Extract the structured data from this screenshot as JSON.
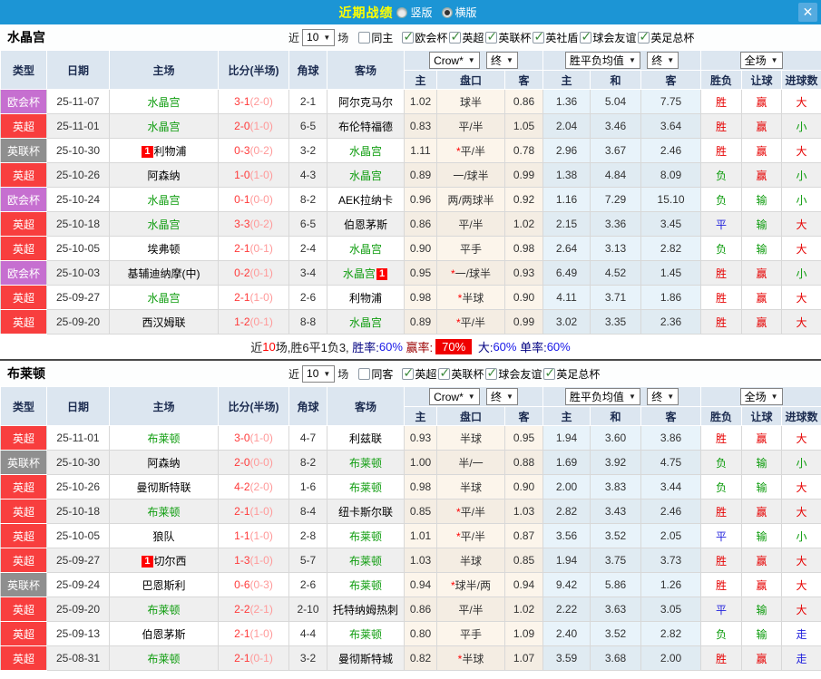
{
  "titlebar": {
    "title": "近期战绩",
    "vertical_label": "竖版",
    "horizontal_label": "横版",
    "selected_mode": "横版",
    "close_label": "✕"
  },
  "columns": {
    "type": "类型",
    "date": "日期",
    "home": "主场",
    "score": "比分(半场)",
    "corner": "角球",
    "away": "客场",
    "select_crow": "Crow*",
    "select_final1": "终",
    "select_avg": "胜平负均值",
    "select_final2": "终",
    "select_full": "全场",
    "sub_headers": [
      "主",
      "盘口",
      "客",
      "主",
      "和",
      "客",
      "胜负",
      "让球",
      "进球数"
    ]
  },
  "type_colors": {
    "欧会杯": "#C66FD0",
    "英超": "#F83E3E",
    "英联杯": "#8F8F8F"
  },
  "result_colors": {
    "胜": "#E60000",
    "赢": "#E60000",
    "大": "#E60000",
    "负": "#0B9B0B",
    "输": "#0B9B0B",
    "小": "#0B9B0B",
    "平": "#2222DD",
    "走": "#2222DD"
  },
  "sections": [
    {
      "team": "水晶宫",
      "near_label": "近",
      "games_value": "10",
      "games_suffix": "场",
      "filters": [
        {
          "label": "同主",
          "checked": false
        },
        {
          "label": "欧会杯",
          "checked": true
        },
        {
          "label": "英超",
          "checked": true
        },
        {
          "label": "英联杯",
          "checked": true
        },
        {
          "label": "英社盾",
          "checked": true
        },
        {
          "label": "球会友谊",
          "checked": true
        },
        {
          "label": "英足总杯",
          "checked": true
        }
      ],
      "rows": [
        {
          "type": "欧会杯",
          "date": "25-11-07",
          "home": "水晶宫",
          "home_green": true,
          "home_badge": null,
          "score": "3-1",
          "half": "(2-0)",
          "corner": "2-1",
          "away": "阿尔克马尔",
          "away_green": false,
          "away_badge": null,
          "odds_h": "1.02",
          "handicap": "球半",
          "star": false,
          "odds_a": "0.86",
          "avg_h": "1.36",
          "avg_d": "5.04",
          "avg_a": "7.75",
          "r_outcome": "胜",
          "r_handicap": "赢",
          "r_goals": "大"
        },
        {
          "type": "英超",
          "date": "25-11-01",
          "home": "水晶宫",
          "home_green": true,
          "home_badge": null,
          "score": "2-0",
          "half": "(1-0)",
          "corner": "6-5",
          "away": "布伦特福德",
          "away_green": false,
          "away_badge": null,
          "odds_h": "0.83",
          "handicap": "平/半",
          "star": false,
          "odds_a": "1.05",
          "avg_h": "2.04",
          "avg_d": "3.46",
          "avg_a": "3.64",
          "r_outcome": "胜",
          "r_handicap": "赢",
          "r_goals": "小"
        },
        {
          "type": "英联杯",
          "date": "25-10-30",
          "home": "利物浦",
          "home_green": false,
          "home_badge": "1",
          "score": "0-3",
          "half": "(0-2)",
          "corner": "3-2",
          "away": "水晶宫",
          "away_green": true,
          "away_badge": null,
          "odds_h": "1.11",
          "handicap": "平/半",
          "star": true,
          "odds_a": "0.78",
          "avg_h": "2.96",
          "avg_d": "3.67",
          "avg_a": "2.46",
          "r_outcome": "胜",
          "r_handicap": "赢",
          "r_goals": "大"
        },
        {
          "type": "英超",
          "date": "25-10-26",
          "home": "阿森纳",
          "home_green": false,
          "home_badge": null,
          "score": "1-0",
          "half": "(1-0)",
          "corner": "4-3",
          "away": "水晶宫",
          "away_green": true,
          "away_badge": null,
          "odds_h": "0.89",
          "handicap": "一/球半",
          "star": false,
          "odds_a": "0.99",
          "avg_h": "1.38",
          "avg_d": "4.84",
          "avg_a": "8.09",
          "r_outcome": "负",
          "r_handicap": "赢",
          "r_goals": "小"
        },
        {
          "type": "欧会杯",
          "date": "25-10-24",
          "home": "水晶宫",
          "home_green": true,
          "home_badge": null,
          "score": "0-1",
          "half": "(0-0)",
          "corner": "8-2",
          "away": "AEK拉纳卡",
          "away_green": false,
          "away_badge": null,
          "odds_h": "0.96",
          "handicap": "两/两球半",
          "star": false,
          "odds_a": "0.92",
          "avg_h": "1.16",
          "avg_d": "7.29",
          "avg_a": "15.10",
          "r_outcome": "负",
          "r_handicap": "输",
          "r_goals": "小"
        },
        {
          "type": "英超",
          "date": "25-10-18",
          "home": "水晶宫",
          "home_green": true,
          "home_badge": null,
          "score": "3-3",
          "half": "(0-2)",
          "corner": "6-5",
          "away": "伯恩茅斯",
          "away_green": false,
          "away_badge": null,
          "odds_h": "0.86",
          "handicap": "平/半",
          "star": false,
          "odds_a": "1.02",
          "avg_h": "2.15",
          "avg_d": "3.36",
          "avg_a": "3.45",
          "r_outcome": "平",
          "r_handicap": "输",
          "r_goals": "大"
        },
        {
          "type": "英超",
          "date": "25-10-05",
          "home": "埃弗顿",
          "home_green": false,
          "home_badge": null,
          "score": "2-1",
          "half": "(0-1)",
          "corner": "2-4",
          "away": "水晶宫",
          "away_green": true,
          "away_badge": null,
          "odds_h": "0.90",
          "handicap": "平手",
          "star": false,
          "odds_a": "0.98",
          "avg_h": "2.64",
          "avg_d": "3.13",
          "avg_a": "2.82",
          "r_outcome": "负",
          "r_handicap": "输",
          "r_goals": "大"
        },
        {
          "type": "欧会杯",
          "date": "25-10-03",
          "home": "基辅迪纳摩(中)",
          "home_green": false,
          "home_badge": null,
          "score": "0-2",
          "half": "(0-1)",
          "corner": "3-4",
          "away": "水晶宫",
          "away_green": true,
          "away_badge": "1",
          "odds_h": "0.95",
          "handicap": "一/球半",
          "star": true,
          "odds_a": "0.93",
          "avg_h": "6.49",
          "avg_d": "4.52",
          "avg_a": "1.45",
          "r_outcome": "胜",
          "r_handicap": "赢",
          "r_goals": "小"
        },
        {
          "type": "英超",
          "date": "25-09-27",
          "home": "水晶宫",
          "home_green": true,
          "home_badge": null,
          "score": "2-1",
          "half": "(1-0)",
          "corner": "2-6",
          "away": "利物浦",
          "away_green": false,
          "away_badge": null,
          "odds_h": "0.98",
          "handicap": "半球",
          "star": true,
          "odds_a": "0.90",
          "avg_h": "4.11",
          "avg_d": "3.71",
          "avg_a": "1.86",
          "r_outcome": "胜",
          "r_handicap": "赢",
          "r_goals": "大"
        },
        {
          "type": "英超",
          "date": "25-09-20",
          "home": "西汉姆联",
          "home_green": false,
          "home_badge": null,
          "score": "1-2",
          "half": "(0-1)",
          "corner": "8-8",
          "away": "水晶宫",
          "away_green": true,
          "away_badge": null,
          "odds_h": "0.89",
          "handicap": "平/半",
          "star": true,
          "odds_a": "0.99",
          "avg_h": "3.02",
          "avg_d": "3.35",
          "avg_a": "2.36",
          "r_outcome": "胜",
          "r_handicap": "赢",
          "r_goals": "大"
        }
      ],
      "summary": {
        "prefix": "近",
        "games": "10",
        "detail": "场,胜6平1负3, ",
        "win_label": "胜率:",
        "win": "60%",
        "profit_label": " 赢率:",
        "profit": "70%",
        "big_label": " 大:",
        "big": "60%",
        "single_label": " 单率:",
        "single": "60%"
      }
    },
    {
      "team": "布莱顿",
      "near_label": "近",
      "games_value": "10",
      "games_suffix": "场",
      "filters": [
        {
          "label": "同客",
          "checked": false
        },
        {
          "label": "英超",
          "checked": true
        },
        {
          "label": "英联杯",
          "checked": true
        },
        {
          "label": "球会友谊",
          "checked": true
        },
        {
          "label": "英足总杯",
          "checked": true
        }
      ],
      "rows": [
        {
          "type": "英超",
          "date": "25-11-01",
          "home": "布莱顿",
          "home_green": true,
          "home_badge": null,
          "score": "3-0",
          "half": "(1-0)",
          "corner": "4-7",
          "away": "利兹联",
          "away_green": false,
          "away_badge": null,
          "odds_h": "0.93",
          "handicap": "半球",
          "star": false,
          "odds_a": "0.95",
          "avg_h": "1.94",
          "avg_d": "3.60",
          "avg_a": "3.86",
          "r_outcome": "胜",
          "r_handicap": "赢",
          "r_goals": "大"
        },
        {
          "type": "英联杯",
          "date": "25-10-30",
          "home": "阿森纳",
          "home_green": false,
          "home_badge": null,
          "score": "2-0",
          "half": "(0-0)",
          "corner": "8-2",
          "away": "布莱顿",
          "away_green": true,
          "away_badge": null,
          "odds_h": "1.00",
          "handicap": "半/一",
          "star": false,
          "odds_a": "0.88",
          "avg_h": "1.69",
          "avg_d": "3.92",
          "avg_a": "4.75",
          "r_outcome": "负",
          "r_handicap": "输",
          "r_goals": "小"
        },
        {
          "type": "英超",
          "date": "25-10-26",
          "home": "曼彻斯特联",
          "home_green": false,
          "home_badge": null,
          "score": "4-2",
          "half": "(2-0)",
          "corner": "1-6",
          "away": "布莱顿",
          "away_green": true,
          "away_badge": null,
          "odds_h": "0.98",
          "handicap": "半球",
          "star": false,
          "odds_a": "0.90",
          "avg_h": "2.00",
          "avg_d": "3.83",
          "avg_a": "3.44",
          "r_outcome": "负",
          "r_handicap": "输",
          "r_goals": "大"
        },
        {
          "type": "英超",
          "date": "25-10-18",
          "home": "布莱顿",
          "home_green": true,
          "home_badge": null,
          "score": "2-1",
          "half": "(1-0)",
          "corner": "8-4",
          "away": "纽卡斯尔联",
          "away_green": false,
          "away_badge": null,
          "odds_h": "0.85",
          "handicap": "平/半",
          "star": true,
          "odds_a": "1.03",
          "avg_h": "2.82",
          "avg_d": "3.43",
          "avg_a": "2.46",
          "r_outcome": "胜",
          "r_handicap": "赢",
          "r_goals": "大"
        },
        {
          "type": "英超",
          "date": "25-10-05",
          "home": "狼队",
          "home_green": false,
          "home_badge": null,
          "score": "1-1",
          "half": "(1-0)",
          "corner": "2-8",
          "away": "布莱顿",
          "away_green": true,
          "away_badge": null,
          "odds_h": "1.01",
          "handicap": "平/半",
          "star": true,
          "odds_a": "0.87",
          "avg_h": "3.56",
          "avg_d": "3.52",
          "avg_a": "2.05",
          "r_outcome": "平",
          "r_handicap": "输",
          "r_goals": "小"
        },
        {
          "type": "英超",
          "date": "25-09-27",
          "home": "切尔西",
          "home_green": false,
          "home_badge": "1",
          "score": "1-3",
          "half": "(1-0)",
          "corner": "5-7",
          "away": "布莱顿",
          "away_green": true,
          "away_badge": null,
          "odds_h": "1.03",
          "handicap": "半球",
          "star": false,
          "odds_a": "0.85",
          "avg_h": "1.94",
          "avg_d": "3.75",
          "avg_a": "3.73",
          "r_outcome": "胜",
          "r_handicap": "赢",
          "r_goals": "大"
        },
        {
          "type": "英联杯",
          "date": "25-09-24",
          "home": "巴恩斯利",
          "home_green": false,
          "home_badge": null,
          "score": "0-6",
          "half": "(0-3)",
          "corner": "2-6",
          "away": "布莱顿",
          "away_green": true,
          "away_badge": null,
          "odds_h": "0.94",
          "handicap": "球半/两",
          "star": true,
          "odds_a": "0.94",
          "avg_h": "9.42",
          "avg_d": "5.86",
          "avg_a": "1.26",
          "r_outcome": "胜",
          "r_handicap": "赢",
          "r_goals": "大"
        },
        {
          "type": "英超",
          "date": "25-09-20",
          "home": "布莱顿",
          "home_green": true,
          "home_badge": null,
          "score": "2-2",
          "half": "(2-1)",
          "corner": "2-10",
          "away": "托特纳姆热刺",
          "away_green": false,
          "away_badge": null,
          "odds_h": "0.86",
          "handicap": "平/半",
          "star": false,
          "odds_a": "1.02",
          "avg_h": "2.22",
          "avg_d": "3.63",
          "avg_a": "3.05",
          "r_outcome": "平",
          "r_handicap": "输",
          "r_goals": "大"
        },
        {
          "type": "英超",
          "date": "25-09-13",
          "home": "伯恩茅斯",
          "home_green": false,
          "home_badge": null,
          "score": "2-1",
          "half": "(1-0)",
          "corner": "4-4",
          "away": "布莱顿",
          "away_green": true,
          "away_badge": null,
          "odds_h": "0.80",
          "handicap": "平手",
          "star": false,
          "odds_a": "1.09",
          "avg_h": "2.40",
          "avg_d": "3.52",
          "avg_a": "2.82",
          "r_outcome": "负",
          "r_handicap": "输",
          "r_goals": "走"
        },
        {
          "type": "英超",
          "date": "25-08-31",
          "home": "布莱顿",
          "home_green": true,
          "home_badge": null,
          "score": "2-1",
          "half": "(0-1)",
          "corner": "3-2",
          "away": "曼彻斯特城",
          "away_green": false,
          "away_badge": null,
          "odds_h": "0.82",
          "handicap": "半球",
          "star": true,
          "odds_a": "1.07",
          "avg_h": "3.59",
          "avg_d": "3.68",
          "avg_a": "2.00",
          "r_outcome": "胜",
          "r_handicap": "赢",
          "r_goals": "走"
        }
      ],
      "summary": null
    }
  ]
}
